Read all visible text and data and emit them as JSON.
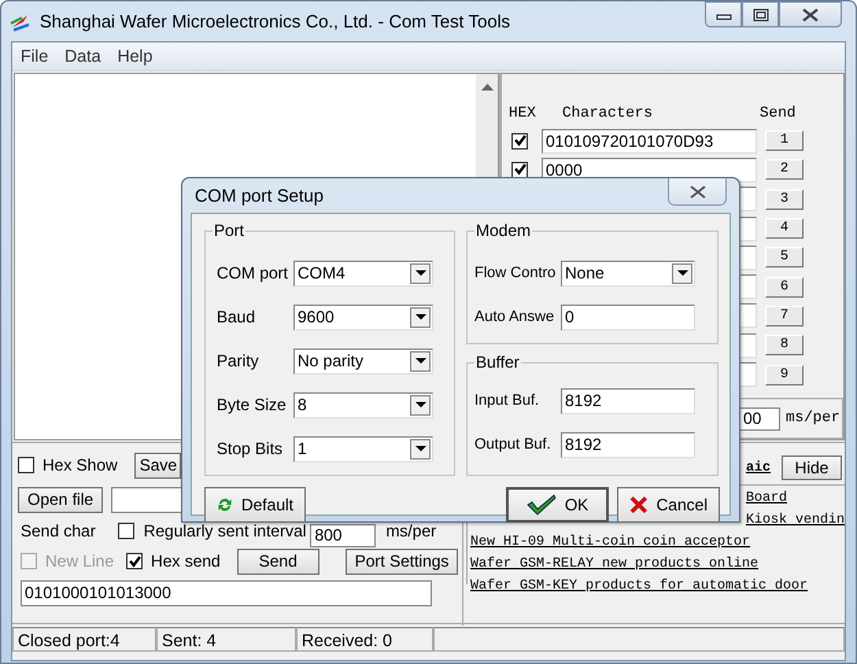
{
  "window": {
    "title": "Shanghai Wafer Microelectronics Co., Ltd. - Com Test Tools"
  },
  "menu": [
    "File",
    "Data",
    "Help"
  ],
  "send_table": {
    "headers": [
      "HEX",
      "Characters",
      "Send"
    ],
    "rows": [
      {
        "hex_checked": true,
        "value": "010109720101070D93",
        "button": "1"
      },
      {
        "hex_checked": true,
        "value": "0000",
        "button": "2"
      },
      {
        "button": "3"
      },
      {
        "button": "4"
      },
      {
        "button": "5"
      },
      {
        "button": "6"
      },
      {
        "button": "7"
      },
      {
        "button": "8"
      },
      {
        "button": "9"
      }
    ],
    "interval": {
      "value": "00",
      "unit": "ms/per"
    }
  },
  "bottom": {
    "hex_show": {
      "label": "Hex Show",
      "checked": false
    },
    "save_button": "Save",
    "open_file_button": "Open file",
    "send_char_label": "Send char",
    "regular": {
      "label": "Regularly sent interval",
      "checked": false
    },
    "interval": {
      "value": "800",
      "unit": "ms/per"
    },
    "new_line": {
      "label": "New Line",
      "checked": false,
      "disabled": true
    },
    "hex_send": {
      "label": "Hex send",
      "checked": true,
      "disabled": false
    },
    "send_button": "Send",
    "port_settings_button": "Port Settings",
    "send_text": "0101000101013000"
  },
  "links_panel": {
    "heading": "aic",
    "hide_button": "Hide",
    "links": [
      {
        "kind": "cut",
        "text": "Board"
      },
      {
        "kind": "cut",
        "text": "Kiosk vendin"
      },
      {
        "kind": "full",
        "text": "New HI-09 Multi-coin coin acceptor"
      },
      {
        "kind": "full",
        "text": "Wafer GSM-RELAY new products online"
      },
      {
        "kind": "full",
        "text": "Wafer GSM-KEY products for automatic door"
      }
    ]
  },
  "status_bar": [
    "Closed port:4",
    "Sent: 4",
    "Received: 0"
  ],
  "dialog": {
    "title": "COM port Setup",
    "groups": [
      {
        "label": "Port",
        "fields": [
          {
            "kind": "dropdown",
            "label": "COM port",
            "value": "COM4"
          },
          {
            "kind": "dropdown",
            "label": "Baud",
            "value": "9600"
          },
          {
            "kind": "dropdown",
            "label": "Parity",
            "value": "No parity"
          },
          {
            "kind": "dropdown",
            "label": "Byte Size",
            "value": "8"
          },
          {
            "kind": "dropdown",
            "label": "Stop Bits",
            "value": "1"
          }
        ]
      },
      {
        "label": "Modem",
        "fields": [
          {
            "kind": "dropdown",
            "label": "Flow Contro",
            "value": "None"
          },
          {
            "kind": "text",
            "label": "Auto Answe",
            "value": "0"
          }
        ]
      },
      {
        "label": "Buffer",
        "fields": [
          {
            "kind": "text",
            "label": "Input Buf.",
            "value": "8192"
          },
          {
            "kind": "text",
            "label": "Output Buf.",
            "value": "8192"
          }
        ]
      }
    ],
    "buttons": [
      {
        "kind": "default",
        "label": "Default"
      },
      {
        "kind": "ok",
        "label": "OK"
      },
      {
        "kind": "cancel",
        "label": "Cancel"
      }
    ]
  }
}
